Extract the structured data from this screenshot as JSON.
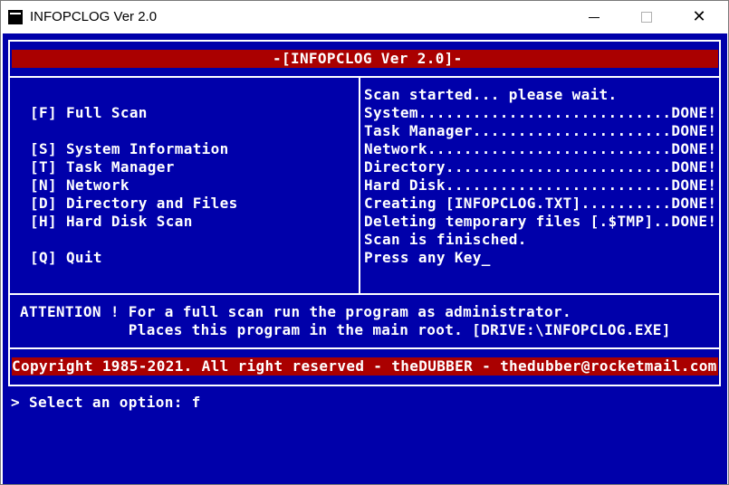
{
  "window": {
    "title": "INFOPCLOG Ver 2.0",
    "icons": {
      "app": "console-app-icon",
      "minimize": "minimize-icon",
      "maximize": "maximize-icon",
      "close": "close-icon"
    },
    "close_glyph": "✕"
  },
  "colors": {
    "background": "#0000aa",
    "text": "#ffffff",
    "banner": "#aa0000"
  },
  "header": {
    "title": "-[INFOPCLOG Ver 2.0]-"
  },
  "menu": {
    "items": [
      {
        "key": "[F]",
        "label": "Full Scan"
      },
      {
        "key": "[S]",
        "label": "System Information"
      },
      {
        "key": "[T]",
        "label": "Task Manager"
      },
      {
        "key": "[N]",
        "label": "Network"
      },
      {
        "key": "[D]",
        "label": "Directory and Files"
      },
      {
        "key": "[H]",
        "label": "Hard Disk Scan"
      },
      {
        "key": "[Q]",
        "label": "Quit"
      }
    ]
  },
  "log": {
    "lines": [
      "Scan started... please wait.",
      "System............................DONE!",
      "Task Manager......................DONE!",
      "Network...........................DONE!",
      "Directory.........................DONE!",
      "Hard Disk.........................DONE!",
      "Creating [INFOPCLOG.TXT]..........DONE!",
      "Deleting temporary files [.$TMP]..DONE!",
      "Scan is finisched.",
      "Press any Key_"
    ]
  },
  "attention": {
    "line1": "ATTENTION ! For a full scan run the program as administrator.",
    "line2": "            Places this program in the main root. [DRIVE:\\INFOPCLOG.EXE]"
  },
  "footer": {
    "copyright": "Copyright 1985-2021. All right reserved - theDUBBER - thedubber@rocketmail.com"
  },
  "prompt": {
    "text": "> Select an option: f"
  }
}
